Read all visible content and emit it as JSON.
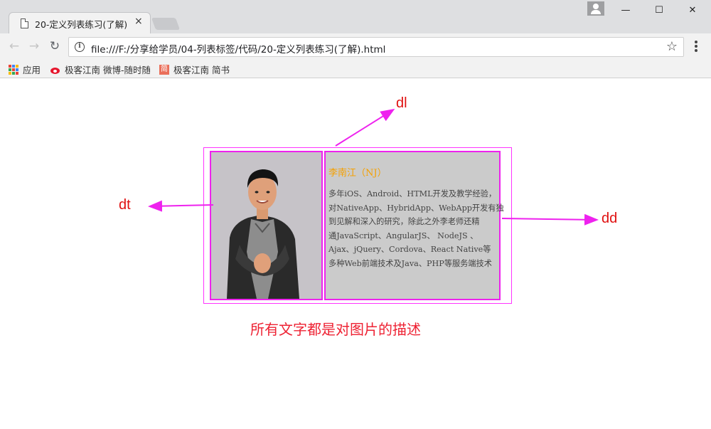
{
  "browser": {
    "tab_title": "20-定义列表练习(了解)",
    "tab_close": "×",
    "url": "file:///F:/分享给学员/04-列表标签/代码/20-定义列表练习(了解).html",
    "window_controls": {
      "minimize": "—",
      "maximize": "☐",
      "close": "✕"
    },
    "nav": {
      "back": "←",
      "forward": "→",
      "reload": "↻"
    },
    "star": "☆",
    "bookmarks": [
      {
        "label": "应用",
        "icon": "apps-grid-icon"
      },
      {
        "label": "极客江南 微博-随时随",
        "icon": "weibo-icon"
      },
      {
        "label": "极客江南 简书",
        "icon": "jianshu-icon",
        "icon_text": "简"
      }
    ]
  },
  "content": {
    "dd_name": "李南江（NJ）",
    "dd_lines": [
      "多年iOS、Android、HTML开发及教学经验，",
      "对NativeApp、HybridApp、WebApp开发有独",
      "到见解和深入的研究，除此之外李老师还精",
      "通JavaScript、AngularJS、 NodeJS 、",
      "Ajax、jQuery、Cordova、React Native等",
      "多种Web前端技术及Java、PHP等服务端技术"
    ],
    "caption": "所有文字都是对图片的描述",
    "annotations": {
      "dl": "dl",
      "dt": "dt",
      "dd": "dd"
    }
  },
  "colors": {
    "accent_magenta": "#ee22ee",
    "annotation_red": "#e01010",
    "name_orange": "#f5a000"
  }
}
